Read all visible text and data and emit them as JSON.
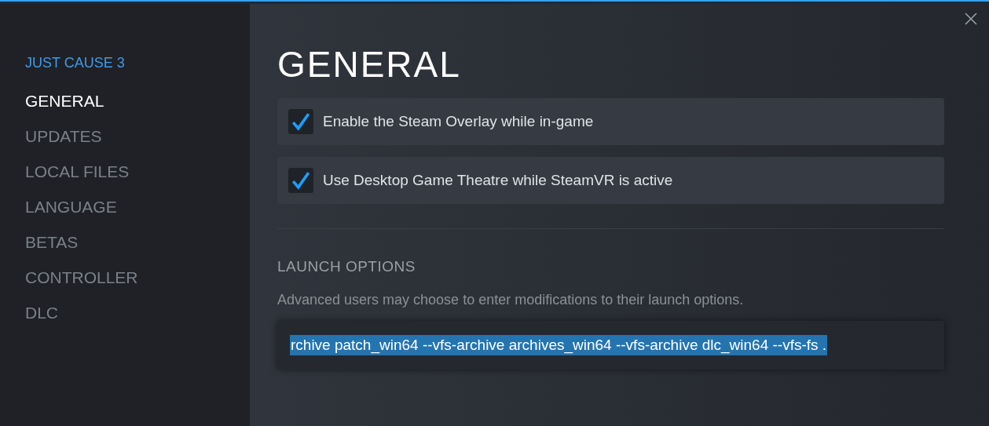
{
  "sidebar": {
    "game_title": "JUST CAUSE 3",
    "items": [
      {
        "label": "GENERAL",
        "selected": true
      },
      {
        "label": "UPDATES",
        "selected": false
      },
      {
        "label": "LOCAL FILES",
        "selected": false
      },
      {
        "label": "LANGUAGE",
        "selected": false
      },
      {
        "label": "BETAS",
        "selected": false
      },
      {
        "label": "CONTROLLER",
        "selected": false
      },
      {
        "label": "DLC",
        "selected": false
      }
    ]
  },
  "page": {
    "heading": "GENERAL",
    "options": [
      {
        "label": "Enable the Steam Overlay while in-game",
        "checked": true
      },
      {
        "label": "Use Desktop Game Theatre while SteamVR is active",
        "checked": true
      }
    ],
    "launch_options": {
      "heading": "LAUNCH OPTIONS",
      "description": "Advanced users may choose to enter modifications to their launch options.",
      "value": "rchive patch_win64 --vfs-archive archives_win64 --vfs-archive dlc_win64 --vfs-fs ."
    }
  }
}
